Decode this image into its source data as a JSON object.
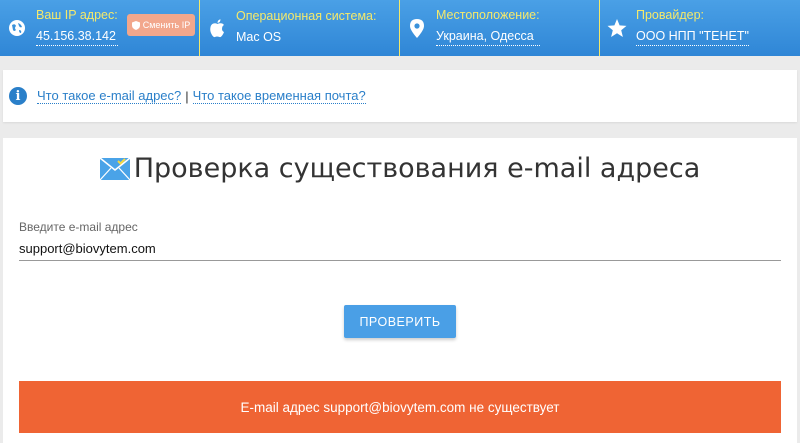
{
  "topbar": {
    "ip": {
      "label": "Ваш IP адрес:",
      "value": "45.156.38.142",
      "change_button": "Сменить IP"
    },
    "os": {
      "label": "Операционная система:",
      "value": "Mac OS"
    },
    "location": {
      "label": "Местоположение:",
      "value": "Украина, Одесса"
    },
    "provider": {
      "label": "Провайдер:",
      "value": "ООО НПП \"ТЕНЕТ\""
    }
  },
  "info": {
    "link1": "Что такое e-mail адрес?",
    "separator": "|",
    "link2": "Что такое временная почта?"
  },
  "main": {
    "title": "Проверка существования e-mail адреса",
    "field_label": "Введите e-mail адрес",
    "email_value": "support@biovytem.com",
    "check_button": "ПРОВЕРИТЬ",
    "result": "E-mail адрес support@biovytem.com не существует"
  },
  "colors": {
    "topbar": "#2f86d6",
    "label_yellow": "#f5e96b",
    "button_blue": "#4a9fe6",
    "result_orange": "#ef6434",
    "change_ip": "#f2a78c"
  }
}
